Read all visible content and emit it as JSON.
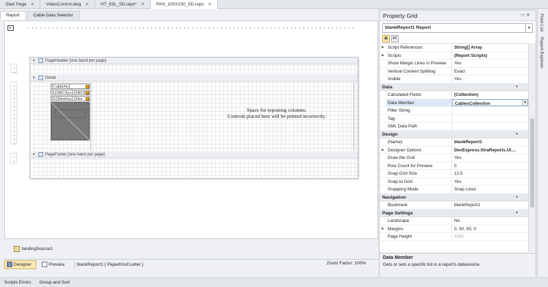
{
  "doc_tabs": [
    {
      "label": "Start Page",
      "active": false
    },
    {
      "label": "VideoControl.dwg",
      "active": false
    },
    {
      "label": "HT_63L_SD.repx*",
      "active": false
    },
    {
      "label": "PAN_100X150_SD.repx",
      "active": true
    }
  ],
  "designer": {
    "sub_tabs": [
      "Report",
      "Cable Data Selector"
    ],
    "bands": {
      "page_header": "PageHeader [one band per page]",
      "detail": "Detail",
      "page_footer": "PageFooter [one band per page]"
    },
    "cells": [
      "[CableNo]",
      "S:[SRCSys]-[SRCE",
      "D:[DestSys]-[Des"
    ],
    "space_text_line1": "Space for repeating columns.",
    "space_text_line2": "Controls placed here will be printed incorrectly.",
    "component": "bindingSource1"
  },
  "status": {
    "designer_label": "Designer",
    "preview_label": "Preview",
    "report_info": "blankReport1 { PaperKind:Letter }",
    "zoom": "Zoom Factor: 100%"
  },
  "bottom_tabs": [
    "Scripts Errors",
    "Group and Sort"
  ],
  "property_grid": {
    "title": "Property Grid",
    "selected_object": "blankReport1   Report",
    "rows": [
      {
        "kind": "prop",
        "expand": true,
        "name": "Script References",
        "value": "String[] Array",
        "bold": true
      },
      {
        "kind": "prop",
        "expand": true,
        "name": "Scripts",
        "value": "(Report Scripts)",
        "bold": true
      },
      {
        "kind": "prop",
        "name": "Show Margin Lines in Preview",
        "value": "Yes"
      },
      {
        "kind": "prop",
        "name": "Vertical Content Splitting",
        "value": "Exact"
      },
      {
        "kind": "prop",
        "name": "Visible",
        "value": "Yes"
      },
      {
        "kind": "cat",
        "name": "Data"
      },
      {
        "kind": "prop",
        "name": "Calculated Fields",
        "value": "(Collection)",
        "bold": true
      },
      {
        "kind": "prop",
        "name": "Data Member",
        "value": "CablesCollection",
        "selected": true
      },
      {
        "kind": "prop",
        "name": "Filter String",
        "value": ""
      },
      {
        "kind": "prop",
        "name": "Tag",
        "value": ""
      },
      {
        "kind": "prop",
        "name": "XML Data Path",
        "value": ""
      },
      {
        "kind": "cat",
        "name": "Design"
      },
      {
        "kind": "prop",
        "name": "(Name)",
        "value": "blankReport1",
        "bold": true
      },
      {
        "kind": "prop",
        "expand": true,
        "name": "Designer Options",
        "value": "DevExpress.XtraReports.UI....",
        "bold": true
      },
      {
        "kind": "prop",
        "name": "Draw the Grid",
        "value": "Yes"
      },
      {
        "kind": "prop",
        "name": "Row Count for Preview",
        "value": "0"
      },
      {
        "kind": "prop",
        "name": "Snap Grid Size",
        "value": "12.5"
      },
      {
        "kind": "prop",
        "name": "Snap to Grid",
        "value": "Yes"
      },
      {
        "kind": "prop",
        "name": "Snapping Mode",
        "value": "Snap Lines"
      },
      {
        "kind": "cat",
        "name": "Navigation"
      },
      {
        "kind": "prop",
        "name": "Bookmark",
        "value": "blankReport1"
      },
      {
        "kind": "cat",
        "name": "Page Settings"
      },
      {
        "kind": "prop",
        "name": "Landscape",
        "value": "No"
      },
      {
        "kind": "prop",
        "expand": true,
        "name": "Margins",
        "value": "0, 50, 50, 0"
      },
      {
        "kind": "prop",
        "name": "Page Height",
        "value": "1100",
        "dim": true
      }
    ],
    "description_title": "Data Member",
    "description_text": "Gets or sets a specific list in a report's datasource."
  },
  "side_tabs": [
    "Field List",
    "Report Explorer"
  ]
}
